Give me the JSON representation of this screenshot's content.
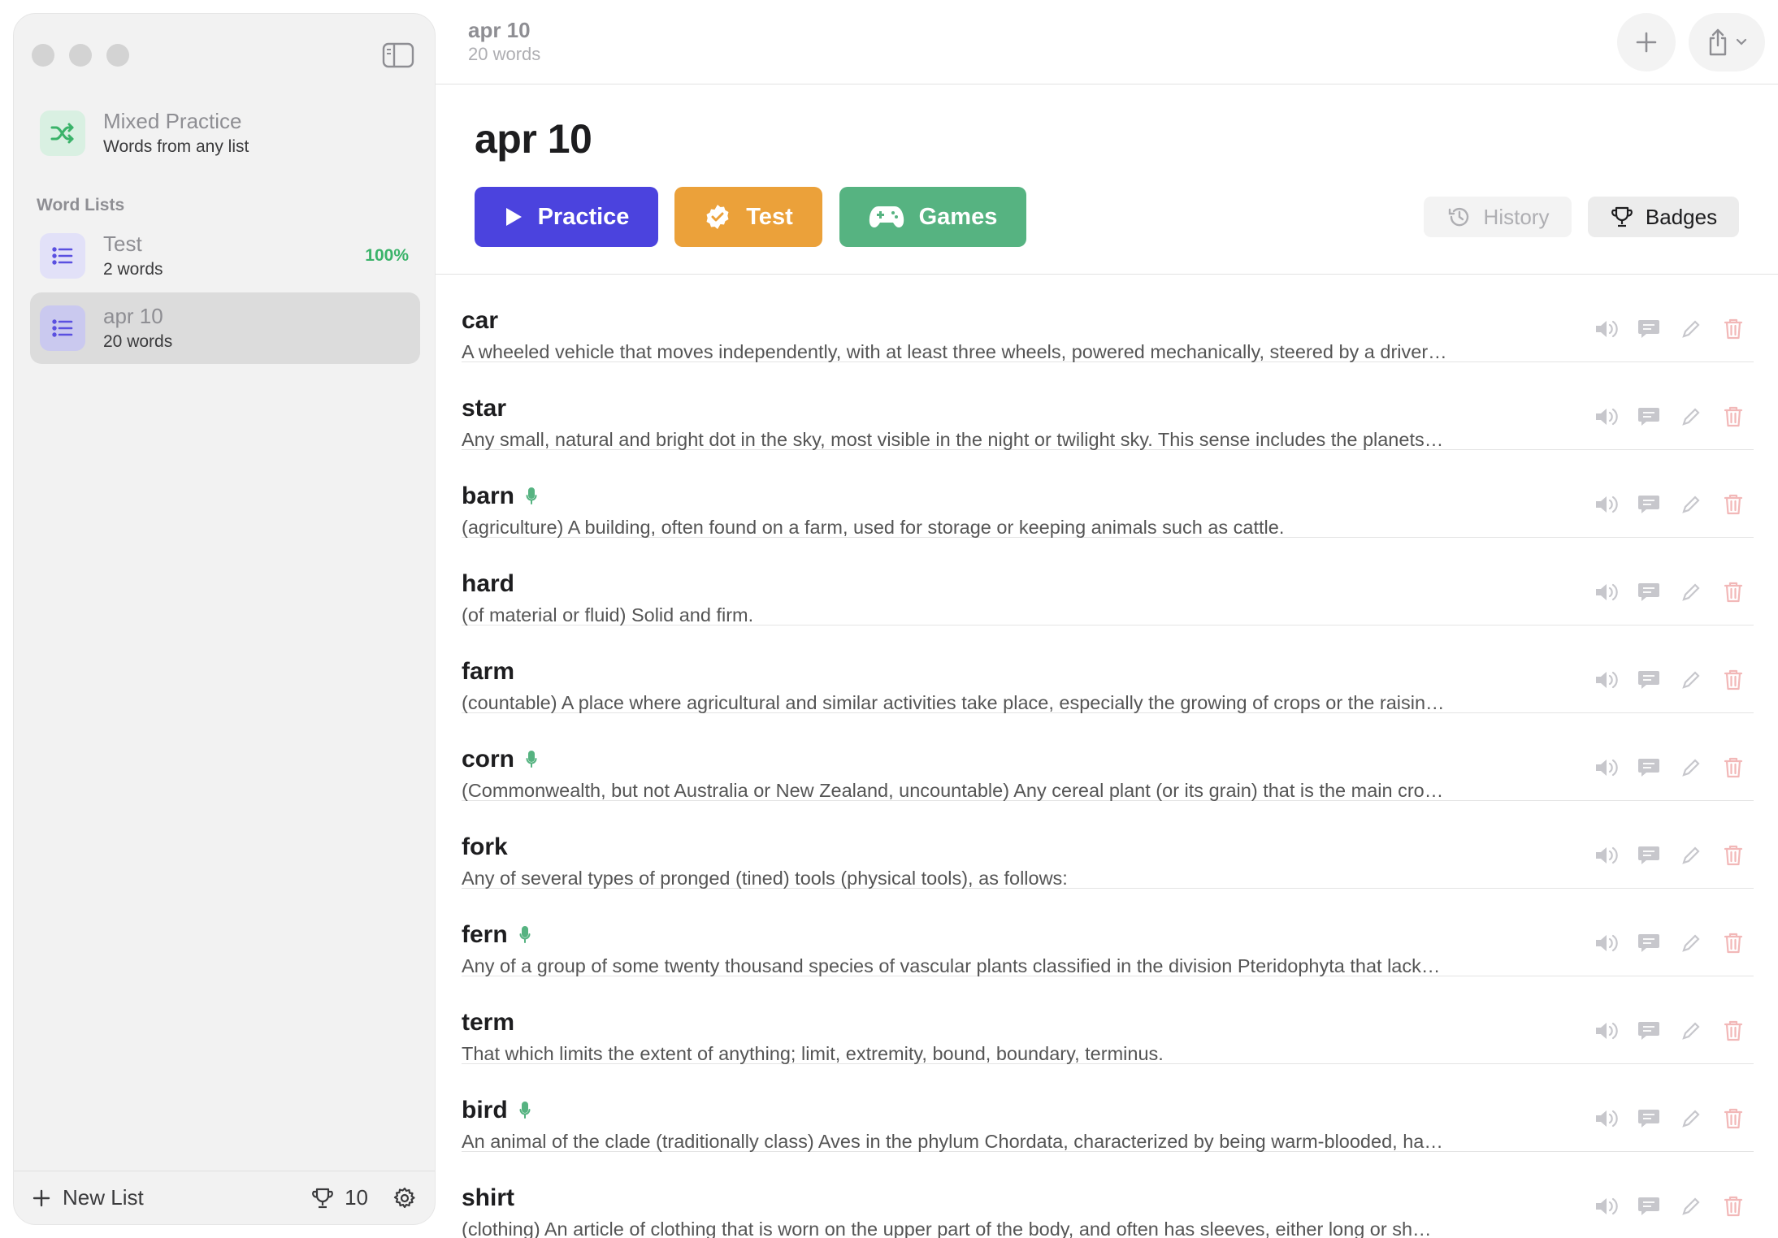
{
  "sidebar": {
    "mixed_practice": {
      "title": "Mixed Practice",
      "subtitle": "Words from any list"
    },
    "section_label": "Word Lists",
    "lists": [
      {
        "title": "Test",
        "subtitle": "2 words",
        "progress": "100%"
      },
      {
        "title": "apr 10",
        "subtitle": "20 words"
      }
    ],
    "footer": {
      "new_list_label": "New List",
      "badge_count": "10"
    }
  },
  "topbar": {
    "title": "apr 10",
    "subtitle": "20 words"
  },
  "main": {
    "title": "apr 10",
    "actions": {
      "practice": "Practice",
      "test": "Test",
      "games": "Games"
    },
    "history_label": "History",
    "badges_label": "Badges"
  },
  "colors": {
    "practice": "#4b43de",
    "test": "#eba13a",
    "games": "#56b381",
    "progress_green": "#3bb36a",
    "delete_red": "#f2b8b8"
  },
  "words": [
    {
      "word": "car",
      "definition": "A wheeled vehicle that moves independently, with at least three wheels, powered mechanically, steered by a driver…",
      "mic": false
    },
    {
      "word": "star",
      "definition": "Any small, natural and bright dot in the sky, most visible in the night or twilight sky. This sense includes the planets…",
      "mic": false
    },
    {
      "word": "barn",
      "definition": "(agriculture) A building, often found on a farm, used for storage or keeping animals such as cattle.",
      "mic": true
    },
    {
      "word": "hard",
      "definition": "(of material or fluid) Solid and firm.",
      "mic": false
    },
    {
      "word": "farm",
      "definition": "(countable) A place where agricultural and similar activities take place, especially the growing of crops or the raisin…",
      "mic": false
    },
    {
      "word": "corn",
      "definition": "(Commonwealth, but not Australia or New Zealand, uncountable) Any cereal plant (or its grain) that is the main cro…",
      "mic": true
    },
    {
      "word": "fork",
      "definition": "Any of several types of pronged (tined) tools (physical tools), as follows:",
      "mic": false
    },
    {
      "word": "fern",
      "definition": "Any of a group of some twenty thousand species of vascular plants classified in the division Pteridophyta that lack…",
      "mic": true
    },
    {
      "word": "term",
      "definition": "That which limits the extent of anything; limit, extremity, bound, boundary, terminus.",
      "mic": false
    },
    {
      "word": "bird",
      "definition": "An animal of the clade (traditionally class) Aves in the phylum Chordata, characterized by being warm-blooded, ha…",
      "mic": true
    },
    {
      "word": "shirt",
      "definition": "(clothing) An article of clothing that is worn on the upper part of the body, and often has sleeves, either long or sh…",
      "mic": false
    }
  ]
}
